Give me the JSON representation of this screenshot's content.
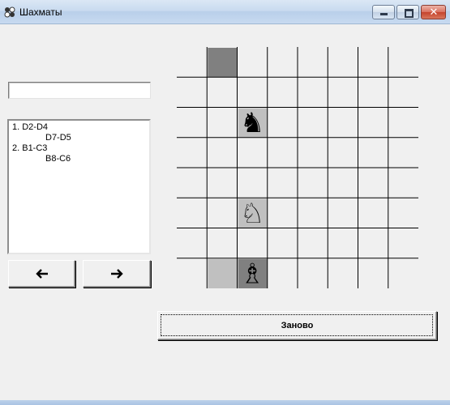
{
  "window": {
    "title": "Шахматы",
    "icon": "chess-app-icon",
    "controls": {
      "minimize_icon": "minimize-icon",
      "maximize_icon": "maximize-icon",
      "close_icon": "close-icon",
      "close_glyph": "✕"
    }
  },
  "move_input": {
    "value": "",
    "placeholder": ""
  },
  "moves": [
    {
      "white": "1. D2-D4",
      "black": "D7-D5"
    },
    {
      "white": "2. B1-C3",
      "black": "B8-C6"
    }
  ],
  "nav": {
    "back_glyph": "🡐",
    "forward_glyph": "🡒",
    "back_icon": "arrow-left-icon",
    "forward_icon": "arrow-right-icon"
  },
  "board": {
    "cells_per_side": 8,
    "visible_rows": 8,
    "highlighted_squares": [
      {
        "col": 1,
        "row": 0,
        "color": "#808080"
      },
      {
        "col": 1,
        "row": 7,
        "color": "#c0c0c0"
      },
      {
        "col": 2,
        "row": 2,
        "color": "#c0c0c0"
      },
      {
        "col": 2,
        "row": 5,
        "color": "#c0c0c0"
      },
      {
        "col": 2,
        "row": 7,
        "color": "#808080"
      }
    ],
    "pieces": [
      {
        "col": 2,
        "row": 2,
        "piece": "black-knight",
        "glyph": "♞"
      },
      {
        "col": 2,
        "row": 5,
        "piece": "white-knight",
        "glyph": "♘"
      },
      {
        "col": 2,
        "row": 7,
        "piece": "white-bishop",
        "glyph": "♗"
      }
    ]
  },
  "reset_button": {
    "label": "Заново"
  },
  "colors": {
    "window_bg": "#f0f0f0",
    "grid_line": "#000000",
    "titlebar": "#c9dbef"
  }
}
